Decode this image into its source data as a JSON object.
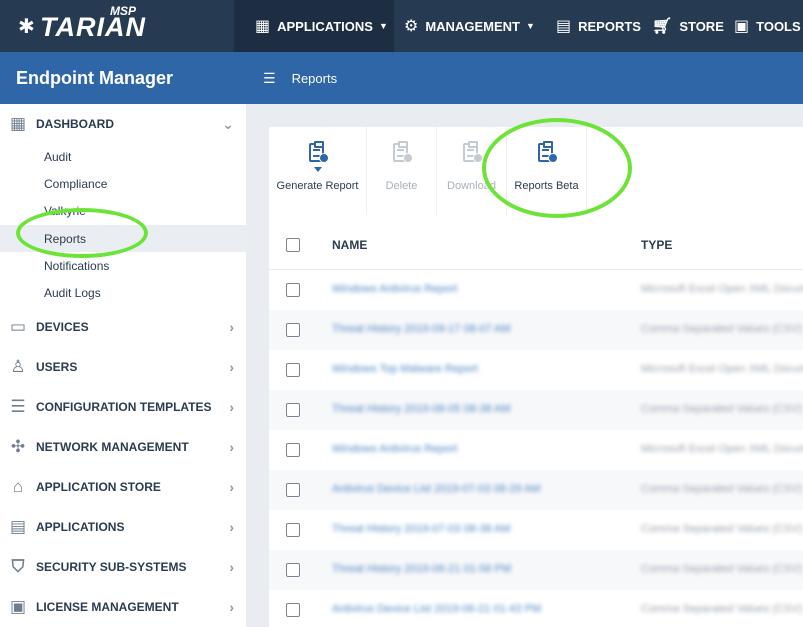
{
  "topbar": {
    "logo_text": "TARIAN",
    "logo_badge": "MSP",
    "nav": [
      {
        "label": "APPLICATIONS",
        "icon": "grid-icon"
      },
      {
        "label": "MANAGEMENT",
        "icon": "gear-icon"
      },
      {
        "label": "REPORTS",
        "icon": "document-icon"
      },
      {
        "label": "STORE",
        "icon": "cart-icon"
      },
      {
        "label": "TOOLS",
        "icon": "toolbox-icon"
      }
    ]
  },
  "sidebar": {
    "title": "Endpoint Manager",
    "dashboard": {
      "label": "DASHBOARD",
      "items": [
        "Audit",
        "Compliance",
        "Valkyrie",
        "Reports",
        "Notifications",
        "Audit Logs"
      ],
      "active": "Reports"
    },
    "sections": [
      {
        "label": "DEVICES",
        "icon": "devices-icon"
      },
      {
        "label": "USERS",
        "icon": "user-icon"
      },
      {
        "label": "CONFIGURATION TEMPLATES",
        "icon": "templates-icon"
      },
      {
        "label": "NETWORK MANAGEMENT",
        "icon": "network-icon"
      },
      {
        "label": "APPLICATION STORE",
        "icon": "basket-icon"
      },
      {
        "label": "APPLICATIONS",
        "icon": "server-icon"
      },
      {
        "label": "SECURITY SUB-SYSTEMS",
        "icon": "shield-icon"
      },
      {
        "label": "LICENSE MANAGEMENT",
        "icon": "license-icon"
      }
    ]
  },
  "header": {
    "title": "Reports"
  },
  "toolbar": {
    "buttons": [
      {
        "label": "Generate Report",
        "enabled": true
      },
      {
        "label": "Delete",
        "enabled": false
      },
      {
        "label": "Download",
        "enabled": false
      },
      {
        "label": "Reports Beta",
        "enabled": true
      }
    ]
  },
  "table": {
    "columns": [
      "NAME",
      "TYPE"
    ],
    "rows": [
      {
        "name": "Windows Antivirus Report",
        "type": "Microsoft Excel Open XML Document"
      },
      {
        "name": "Threat History 2019-09-17 08-07 AM",
        "type": "Comma Separated Values (CSV)"
      },
      {
        "name": "Windows Top Malware Report",
        "type": "Microsoft Excel Open XML Document"
      },
      {
        "name": "Threat History 2019-08-05 08-38 AM",
        "type": "Comma Separated Values (CSV)"
      },
      {
        "name": "Windows Antivirus Report",
        "type": "Microsoft Excel Open XML Document"
      },
      {
        "name": "Antivirus Device List 2019-07-03 08-29 AM",
        "type": "Comma Separated Values (CSV)"
      },
      {
        "name": "Threat History 2019-07-03 08-38 AM",
        "type": "Comma Separated Values (CSV)"
      },
      {
        "name": "Threat History 2019-06-21 01-56 PM",
        "type": "Comma Separated Values (CSV)"
      },
      {
        "name": "Antivirus Device List 2019-06-21 01-43 PM",
        "type": "Comma Separated Values (CSV)"
      }
    ]
  },
  "colors": {
    "topbar": "#263a52",
    "accent_blue": "#2e66a8",
    "annotation_green": "#6de339",
    "link_blue": "#4f86c6"
  }
}
